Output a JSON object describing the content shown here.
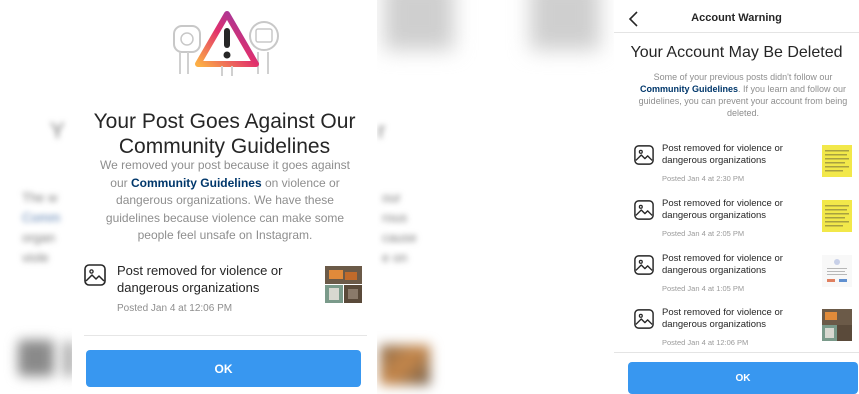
{
  "colors": {
    "accent": "#3897f0",
    "link": "#00376b",
    "muted_text": "#8e8e8e",
    "warning_gradient": [
      "#fcaf45",
      "#e1306c",
      "#833ab4"
    ]
  },
  "left_dialog": {
    "title": "Your Post Goes Against Our Community Guidelines",
    "description": {
      "before": "We removed your post because it goes against our ",
      "link": "Community Guidelines",
      "after": " on violence or dangerous organizations. We have these guidelines because violence can make some people feel unsafe on Instagram."
    },
    "item": {
      "icon": "image-icon",
      "text": "Post removed for violence or dangerous organizations",
      "meta": "Posted Jan 4 at 12:06 PM"
    },
    "ok_label": "OK"
  },
  "right_screen": {
    "header_title": "Account Warning",
    "title": "Your Account May Be Deleted",
    "description": {
      "before": "Some of your previous posts didn't follow our ",
      "link": "Community Guidelines",
      "after": ". If you learn and follow our guidelines, you can prevent your account from being deleted."
    },
    "items": [
      {
        "icon": "image-icon",
        "text": "Post removed for violence or dangerous organizations",
        "meta": "Posted Jan 4 at 2:30 PM",
        "thumb": "yellow-text-thumbnail"
      },
      {
        "icon": "image-icon",
        "text": "Post removed for violence or dangerous organizations",
        "meta": "Posted Jan 4 at 2:05 PM",
        "thumb": "yellow-text-thumbnail"
      },
      {
        "icon": "image-icon",
        "text": "Post removed for violence or dangerous organizations",
        "meta": "Posted Jan 4 at 1:05 PM",
        "thumb": "document-thumbnail"
      },
      {
        "icon": "image-icon",
        "text": "Post removed for violence or dangerous organizations",
        "meta": "Posted Jan 4 at 12:06 PM",
        "thumb": "photo-collage-thumbnail"
      }
    ],
    "ok_label": "OK"
  }
}
